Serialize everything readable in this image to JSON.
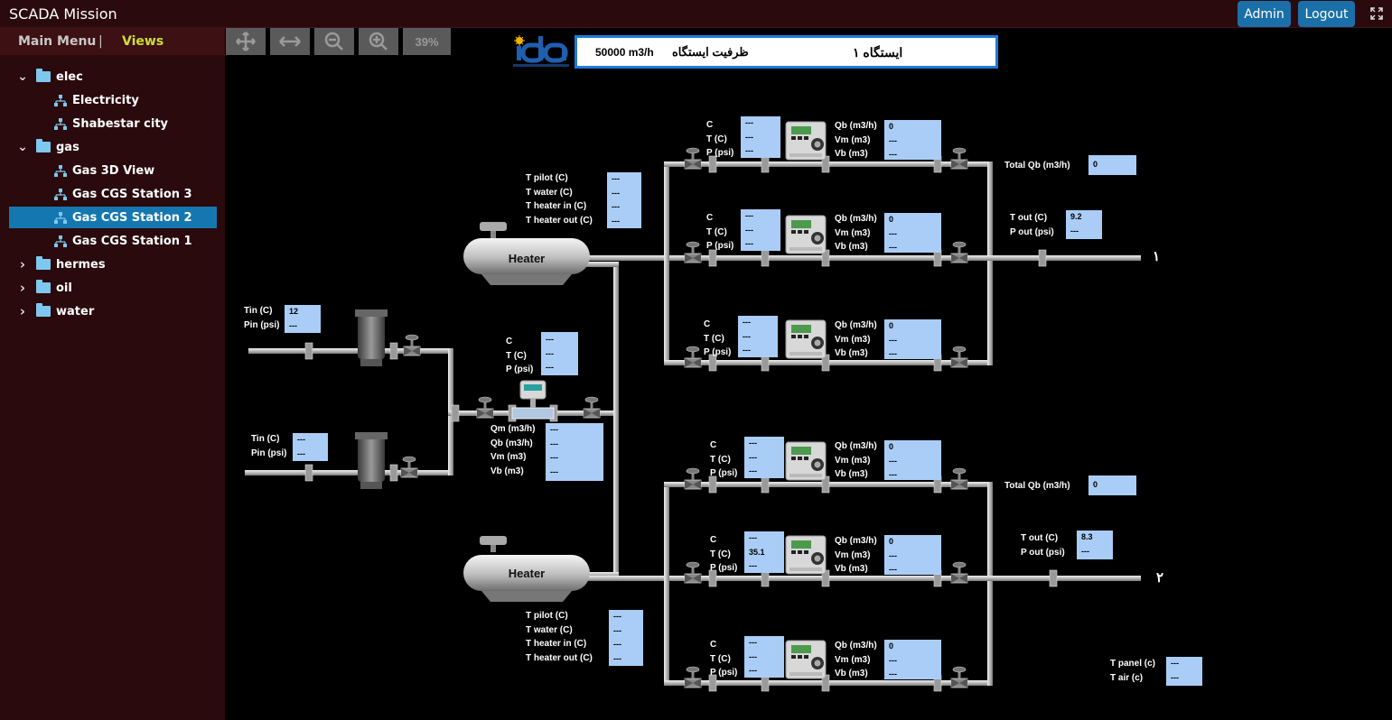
{
  "app": {
    "title": "SCADA Mission"
  },
  "header": {
    "admin_label": "Admin",
    "logout_label": "Logout"
  },
  "menu": {
    "main_label": "Main Menu",
    "separator": "|",
    "views_label": "Views"
  },
  "tree": [
    {
      "label": "elec",
      "type": "folder",
      "expanded": true
    },
    {
      "label": "Electricity",
      "type": "view"
    },
    {
      "label": "Shabestar city",
      "type": "view"
    },
    {
      "label": "gas",
      "type": "folder",
      "expanded": true
    },
    {
      "label": "Gas 3D View",
      "type": "view"
    },
    {
      "label": "Gas CGS Station 3",
      "type": "view"
    },
    {
      "label": "Gas CGS Station 2",
      "type": "view",
      "selected": true
    },
    {
      "label": "Gas CGS Station 1",
      "type": "view"
    },
    {
      "label": "hermes",
      "type": "folder",
      "expanded": false
    },
    {
      "label": "oil",
      "type": "folder",
      "expanded": false
    },
    {
      "label": "water",
      "type": "folder",
      "expanded": false
    }
  ],
  "toolbar": {
    "zoom_level": "39%"
  },
  "banner": {
    "capacity": "50000 m3/h",
    "capacity_label": "ظرفیت ایستگاه",
    "station_name": "ایستگاه ۱"
  },
  "logo": {
    "text": "ida",
    "subtext": "Intelligent Data Aim Ltd."
  },
  "inlets": [
    {
      "tin_label": "Tin (C)",
      "pin_label": "Pin (psi)",
      "tin": "12",
      "pin": "---"
    },
    {
      "tin_label": "Tin (C)",
      "pin_label": "Pin (psi)",
      "tin": "---",
      "pin": "---"
    }
  ],
  "main_meter": {
    "labels": [
      "C",
      "T (C)",
      "P (psi)"
    ],
    "values": [
      "---",
      "---",
      "---"
    ],
    "flow_labels": [
      "Qm (m3/h)",
      "Qb (m3/h)",
      "Vm (m3)",
      "Vb (m3)"
    ],
    "flow_values": [
      "---",
      "---",
      "---",
      "---"
    ]
  },
  "heaters": [
    {
      "label": "Heater",
      "labels": [
        "T pilot (C)",
        "T water (C)",
        "T heater in (C)",
        "T heater out (C)"
      ],
      "values": [
        "---",
        "---",
        "---",
        "---"
      ]
    },
    {
      "label": "Heater",
      "labels": [
        "T pilot (C)",
        "T water (C)",
        "T heater in (C)",
        "T heater out (C)"
      ],
      "values": [
        "---",
        "---",
        "---",
        "---"
      ]
    }
  ],
  "runs": [
    {
      "c": "---",
      "t": "---",
      "p": "---",
      "qb": "0",
      "vm": "---",
      "vb": "---"
    },
    {
      "c": "---",
      "t": "---",
      "p": "---",
      "qb": "0",
      "vm": "---",
      "vb": "---"
    },
    {
      "c": "---",
      "t": "---",
      "p": "---",
      "qb": "0",
      "vm": "---",
      "vb": "---"
    },
    {
      "c": "---",
      "t": "---",
      "p": "---",
      "qb": "0",
      "vm": "---",
      "vb": "---"
    },
    {
      "c": "---",
      "t": "35.1",
      "p": "---",
      "qb": "0",
      "vm": "---",
      "vb": "---"
    },
    {
      "c": "---",
      "t": "---",
      "p": "---",
      "qb": "0",
      "vm": "---",
      "vb": "---"
    }
  ],
  "run_labels": {
    "c": "C",
    "t": "T (C)",
    "p": "P (psi)",
    "qb": "Qb (m3/h)",
    "vm": "Vm (m3)",
    "vb": "Vb (m3)"
  },
  "outputs": [
    {
      "total_qb_label": "Total Qb (m3/h)",
      "total_qb": "0",
      "tout_label": "T out (C)",
      "pout_label": "P out (psi)",
      "tout": "9.2",
      "pout": "---",
      "number": "۱"
    },
    {
      "total_qb_label": "Total Qb (m3/h)",
      "total_qb": "0",
      "tout_label": "T out (C)",
      "pout_label": "P out (psi)",
      "tout": "8.3",
      "pout": "---",
      "number": "۲"
    }
  ],
  "panel": {
    "labels": [
      "T panel (c)",
      "T air (c)"
    ],
    "values": [
      "---",
      "---"
    ]
  },
  "colors": {
    "pipe": "#c9c9c9",
    "value_box": "#a9cdf6",
    "selected": "#1577b0",
    "banner_border": "#1e7ad8",
    "views_accent": "#cde030"
  }
}
